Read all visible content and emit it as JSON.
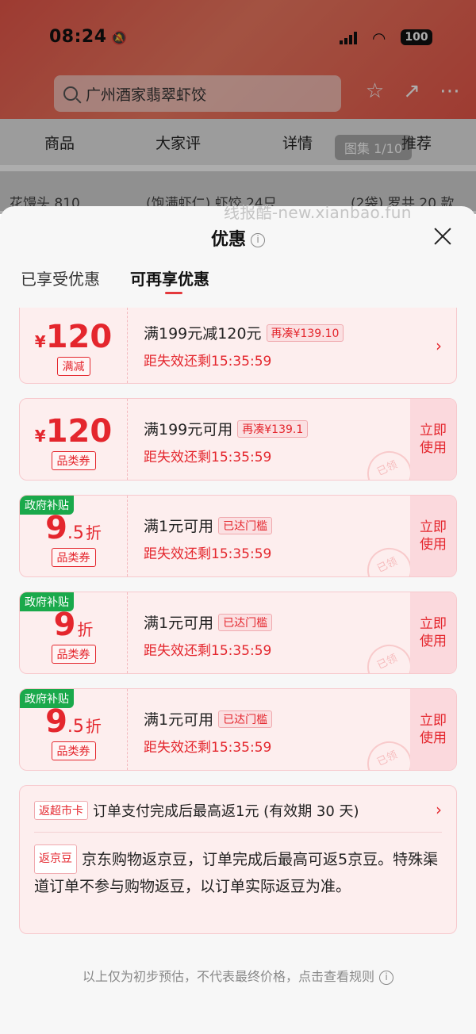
{
  "status": {
    "time": "08:24",
    "battery": "100"
  },
  "search": {
    "text": "广州酒家翡翠虾饺"
  },
  "nav": {
    "items": [
      "商品",
      "大家评",
      "详情",
      "推荐"
    ],
    "gallery": "图集 1/10"
  },
  "strip": {
    "items": [
      "花馒头 810",
      "(饱满虾仁) 虾饺 24只",
      "(2袋) 罗",
      "共 20 款"
    ]
  },
  "watermark": "线报酷-new.xianbao.fun",
  "sheet": {
    "title": "优惠",
    "tabs": [
      "已享受优惠",
      "可再享优惠"
    ],
    "coupons": [
      {
        "currency": "¥",
        "amount": "120",
        "tag": "满减",
        "cond": "满199元减120元",
        "badge": "再凑¥139.10",
        "timer": "距失效还剩15:35:59"
      },
      {
        "currency": "¥",
        "amount": "120",
        "tag": "品类券",
        "cond": "满199元可用",
        "badge": "再凑¥139.1",
        "timer": "距失效还剩15:35:59",
        "use": "立即使用",
        "stamp": "已领"
      },
      {
        "gov": "政府补贴",
        "amount": "9",
        "decimal": ".5",
        "unit": "折",
        "tag": "品类券",
        "cond": "满1元可用",
        "badge": "已达门槛",
        "timer": "距失效还剩15:35:59",
        "use": "立即使用",
        "stamp": "已领"
      },
      {
        "gov": "政府补贴",
        "amount": "9",
        "unit": "折",
        "tag": "品类券",
        "cond": "满1元可用",
        "badge": "已达门槛",
        "timer": "距失效还剩15:35:59",
        "use": "立即使用",
        "stamp": "已领"
      },
      {
        "gov": "政府补贴",
        "amount": "9",
        "decimal": ".5",
        "unit": "折",
        "tag": "品类券",
        "cond": "满1元可用",
        "badge": "已达门槛",
        "timer": "距失效还剩15:35:59",
        "use": "立即使用",
        "stamp": "已领"
      }
    ],
    "rebate": {
      "tag1": "返超市卡",
      "text1": "订单支付完成后最高返1元 (有效期 30 天)",
      "tag2": "返京豆",
      "text2": "京东购物返京豆，订单完成后最高可返5京豆。特殊渠道订单不参与购物返豆，以订单实际返豆为准。"
    },
    "footer": "以上仅为初步预估，不代表最终价格，点击查看规则"
  }
}
